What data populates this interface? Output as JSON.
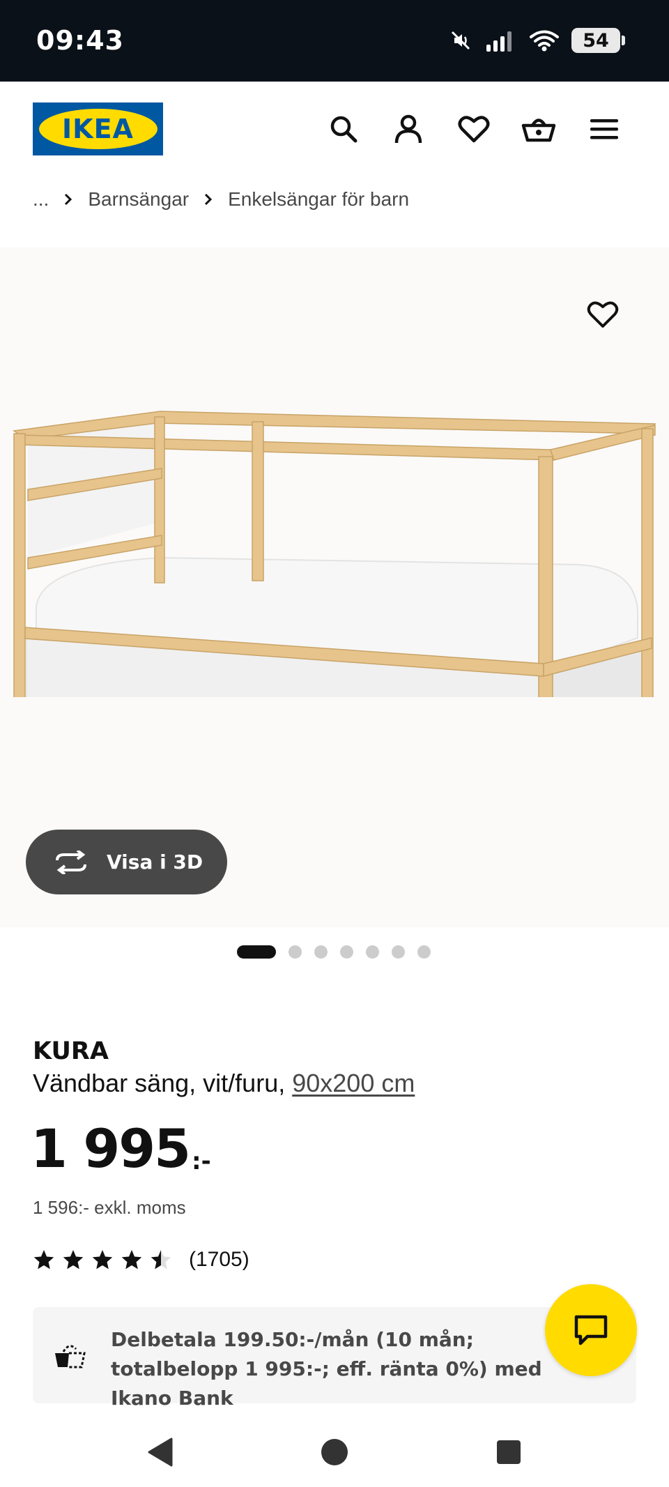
{
  "status_bar": {
    "time": "09:43",
    "battery": "54",
    "icons": [
      "mute-icon",
      "signal-icon",
      "wifi-icon",
      "battery-icon"
    ]
  },
  "header": {
    "logo_text": "IKEA",
    "icons": [
      "search-icon",
      "account-icon",
      "favorites-icon",
      "cart-icon",
      "menu-icon"
    ]
  },
  "breadcrumb": {
    "items": [
      "...",
      "Barnsängar",
      "Enkelsängar för barn"
    ]
  },
  "gallery": {
    "view_3d_label": "Visa i 3D",
    "dot_count": 7,
    "active_index": 0
  },
  "product": {
    "name": "KURA",
    "description": "Vändbar säng, vit/furu,",
    "size": "90x200 cm",
    "price": "1 995",
    "price_suffix": ":-",
    "price_excl": "1 596:- exkl. moms",
    "rating": 4.5,
    "rating_count": "(1705)"
  },
  "payment": {
    "text": "Delbetala 199.50:-/mån (10 mån; totalbelopp 1 995:-; eff. ränta 0%) med Ikano Bank"
  },
  "colors": {
    "ikea_blue": "#0058a3",
    "ikea_yellow": "#ffdb00",
    "dark_gray": "#484848"
  }
}
